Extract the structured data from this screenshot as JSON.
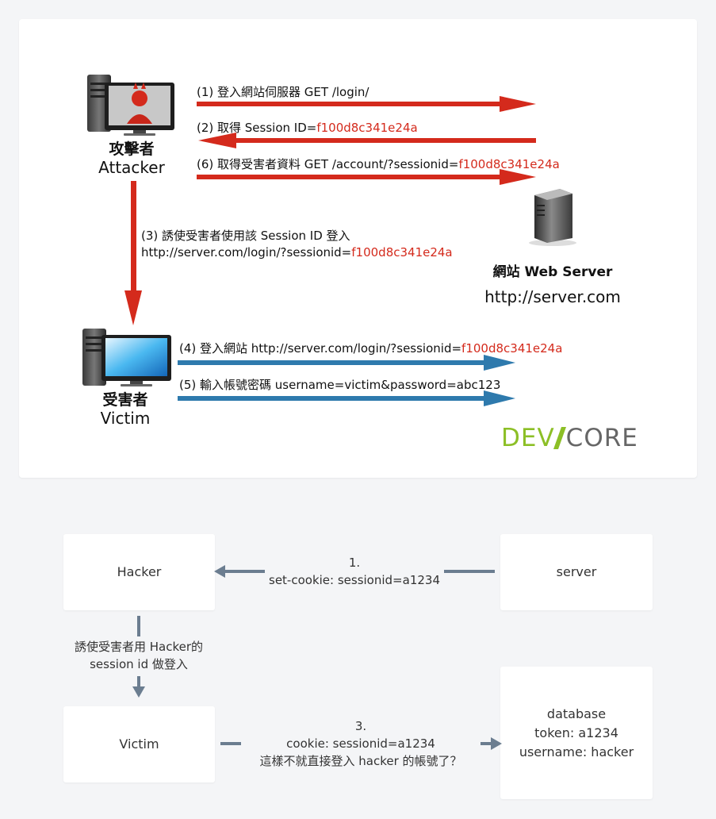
{
  "top": {
    "arrows": [
      {
        "prefix": "(1) 登入網站伺服器 GET /login/",
        "suffix": ""
      },
      {
        "prefix": "(2) 取得 Session ID=",
        "suffix": "f100d8c341e24a"
      },
      {
        "prefix": "(6) 取得受害者資料 GET /account/?sessionid=",
        "suffix": "f100d8c341e24a"
      },
      {
        "prefix": "(4) 登入網站 http://server.com/login/?sessionid=",
        "suffix": "f100d8c341e24a"
      },
      {
        "prefix": "(5) 輸入帳號密碼 username=victim&password=abc123",
        "suffix": ""
      }
    ],
    "step3_line1": "(3) 誘使受害者使用該 Session ID 登入",
    "step3_line2_prefix": "http://server.com/login/?sessionid=",
    "step3_line2_suffix": "f100d8c341e24a",
    "attacker_zh": "攻擊者",
    "attacker_en": "Attacker",
    "victim_zh": "受害者",
    "victim_en": "Victim",
    "server_label": "網站 Web Server",
    "server_url": "http://server.com",
    "logo_a": "DEV",
    "logo_b": "CORE",
    "colors": {
      "red": "#d42a1c",
      "blue": "#2e7aad",
      "green": "#8cbf26"
    }
  },
  "bottom": {
    "hacker": "Hacker",
    "server": "server",
    "victim": "Victim",
    "database_lines": [
      "database",
      "token: a1234",
      "username: hacker"
    ],
    "step1_num": "1.",
    "step1_text": "set-cookie: sessionid=a1234",
    "step2_line1": "誘使受害者用 Hacker的",
    "step2_line2": "session id  做登入",
    "step3_num": "3.",
    "step3_line1": "cookie: sessionid=a1234",
    "step3_line2": "這樣不就直接登入 hacker 的帳號了？",
    "arrow_color": "#6b7d90"
  }
}
